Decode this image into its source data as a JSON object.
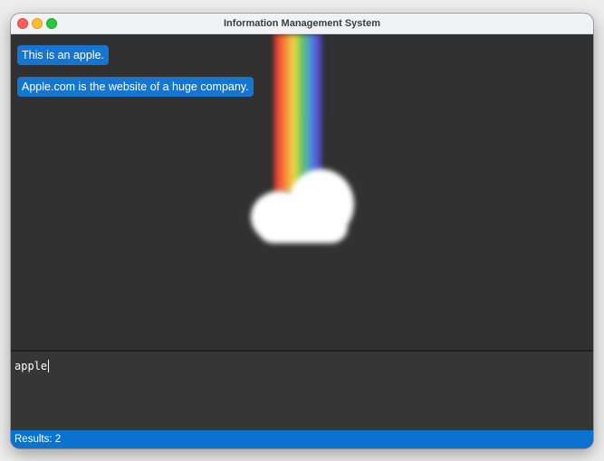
{
  "window": {
    "title": "Information Management System"
  },
  "results": {
    "items": [
      {
        "label": "This is an apple."
      },
      {
        "label": "Apple.com is the website of a huge company."
      }
    ]
  },
  "query": {
    "value": "apple"
  },
  "status": {
    "text": "Results: 2"
  },
  "colors": {
    "accent": "#1675cf",
    "status_bar": "#0a72cf",
    "background": "#313131"
  },
  "icons": {
    "illustration": "rainbow-cloud-illustration"
  }
}
